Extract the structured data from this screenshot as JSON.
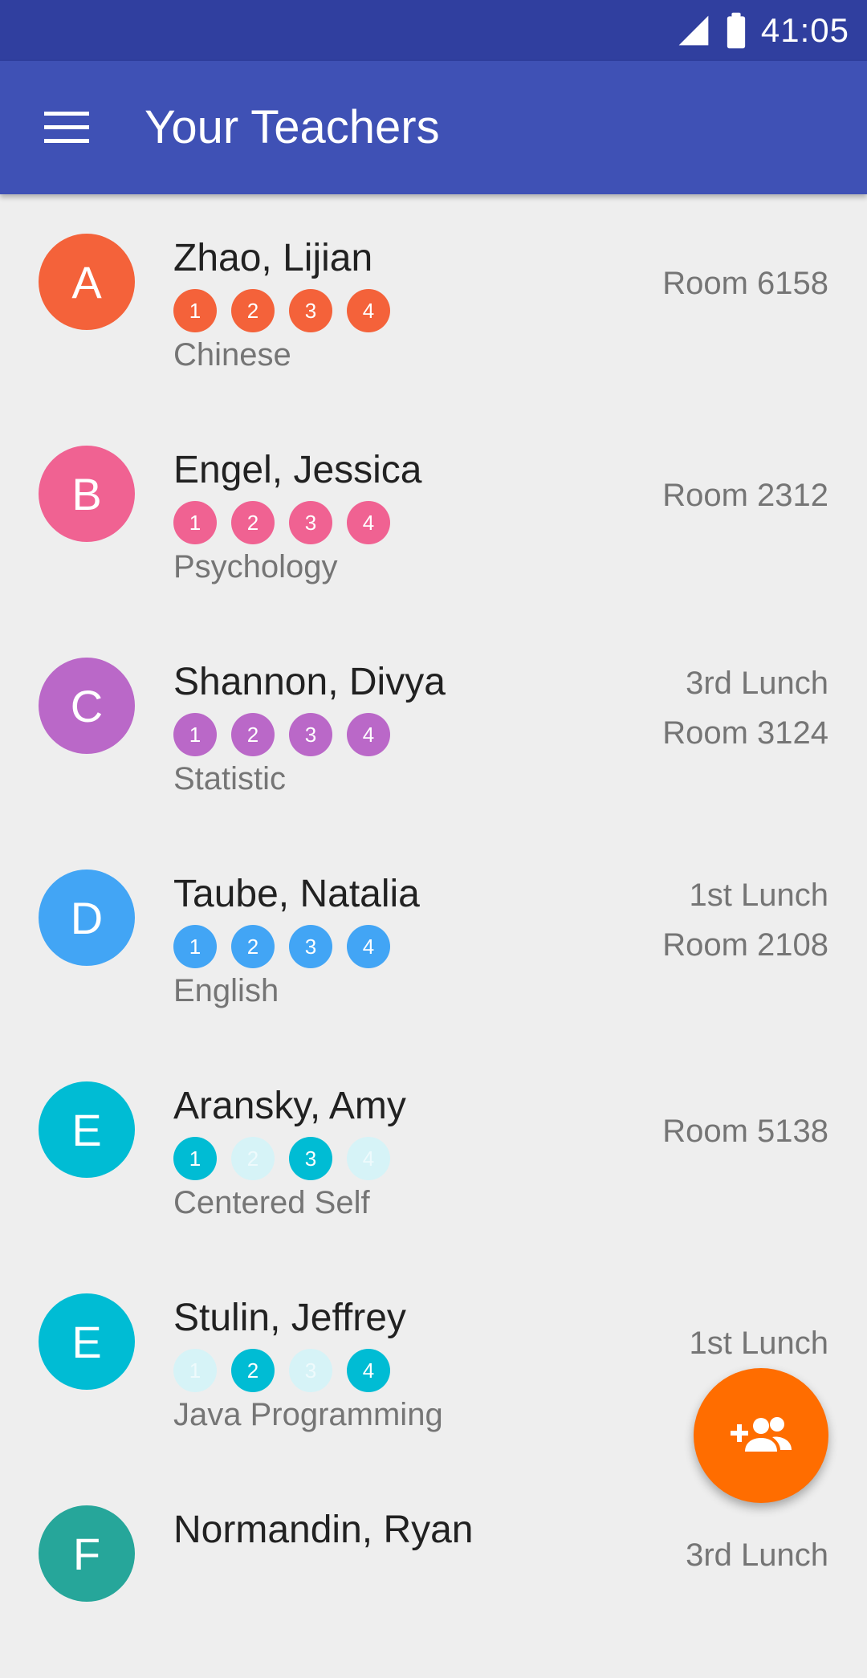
{
  "status_bar": {
    "time": "41:05",
    "signal_icon": "signal-icon",
    "battery_icon": "battery-icon"
  },
  "app_bar": {
    "title": "Your Teachers",
    "menu_icon": "menu-icon"
  },
  "colors": {
    "status_bar": "#303f9f",
    "app_bar": "#3f51b5",
    "fab": "#ff6d00",
    "orange": "#f4623a",
    "pink": "#f06292",
    "purple": "#ba68c8",
    "blue": "#42a5f5",
    "cyan": "#00bcd4",
    "teal": "#26a69a"
  },
  "teachers": [
    {
      "initial": "A",
      "name": "Zhao, Lijian",
      "subject": "Chinese",
      "lunch": "",
      "room": "Room 6158",
      "color": "#f4623a",
      "periods": [
        {
          "label": "1",
          "active": true
        },
        {
          "label": "2",
          "active": true
        },
        {
          "label": "3",
          "active": true
        },
        {
          "label": "4",
          "active": true
        }
      ]
    },
    {
      "initial": "B",
      "name": "Engel, Jessica",
      "subject": "Psychology",
      "lunch": "",
      "room": "Room 2312",
      "color": "#f06292",
      "periods": [
        {
          "label": "1",
          "active": true
        },
        {
          "label": "2",
          "active": true
        },
        {
          "label": "3",
          "active": true
        },
        {
          "label": "4",
          "active": true
        }
      ]
    },
    {
      "initial": "C",
      "name": "Shannon, Divya",
      "subject": "Statistic",
      "lunch": "3rd Lunch",
      "room": "Room 3124",
      "color": "#ba68c8",
      "periods": [
        {
          "label": "1",
          "active": true
        },
        {
          "label": "2",
          "active": true
        },
        {
          "label": "3",
          "active": true
        },
        {
          "label": "4",
          "active": true
        }
      ]
    },
    {
      "initial": "D",
      "name": "Taube, Natalia",
      "subject": "English",
      "lunch": "1st Lunch",
      "room": "Room 2108",
      "color": "#42a5f5",
      "periods": [
        {
          "label": "1",
          "active": true
        },
        {
          "label": "2",
          "active": true
        },
        {
          "label": "3",
          "active": true
        },
        {
          "label": "4",
          "active": true
        }
      ]
    },
    {
      "initial": "E",
      "name": "Aransky, Amy",
      "subject": "Centered Self",
      "lunch": "",
      "room": "Room 5138",
      "color": "#00bcd4",
      "periods": [
        {
          "label": "1",
          "active": true
        },
        {
          "label": "2",
          "active": false
        },
        {
          "label": "3",
          "active": true
        },
        {
          "label": "4",
          "active": false
        }
      ]
    },
    {
      "initial": "E",
      "name": "Stulin, Jeffrey",
      "subject": "Java Programming",
      "lunch": "1st Lunch",
      "room": "",
      "color": "#00bcd4",
      "periods": [
        {
          "label": "1",
          "active": false
        },
        {
          "label": "2",
          "active": true
        },
        {
          "label": "3",
          "active": false
        },
        {
          "label": "4",
          "active": true
        }
      ]
    },
    {
      "initial": "F",
      "name": "Normandin, Ryan",
      "subject": "",
      "lunch": "3rd Lunch",
      "room": "",
      "color": "#26a69a",
      "periods": []
    }
  ],
  "fab": {
    "icon": "add-group-icon"
  }
}
